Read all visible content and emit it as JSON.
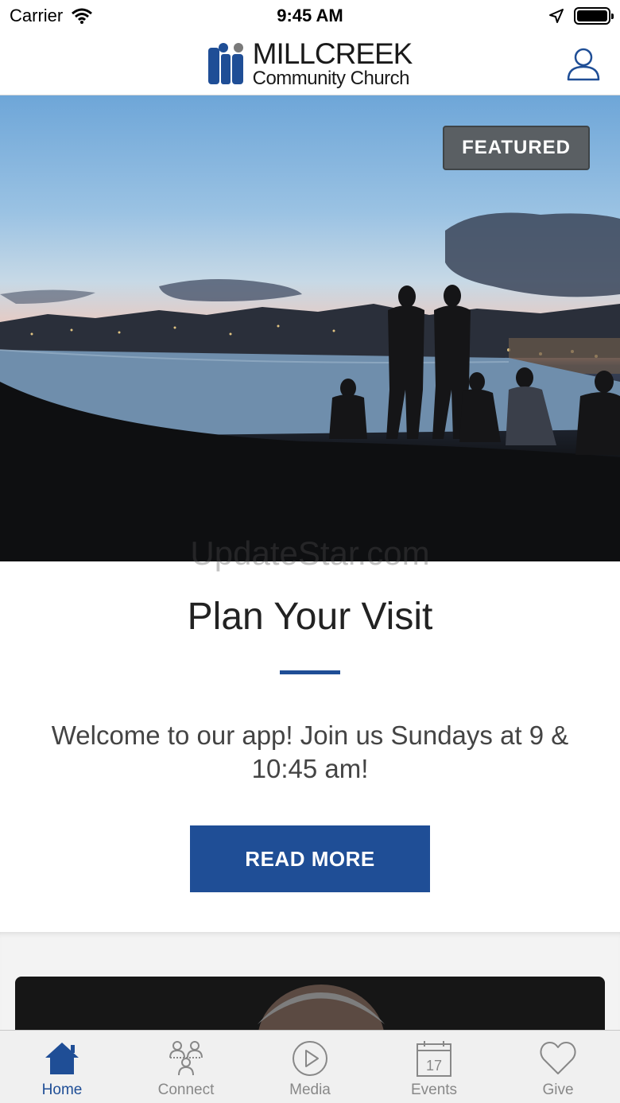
{
  "status_bar": {
    "carrier": "Carrier",
    "time": "9:45 AM"
  },
  "header": {
    "logo_line1": "MILLCREEK",
    "logo_line2": "Community Church"
  },
  "hero": {
    "badge": "FEATURED",
    "watermark": "UpdateStar.com"
  },
  "card": {
    "title": "Plan Your Visit",
    "body": "Welcome to our app! Join us Sundays at 9 & 10:45 am!",
    "button": "READ MORE"
  },
  "tabs": [
    {
      "label": "Home",
      "icon": "home-icon",
      "active": true
    },
    {
      "label": "Connect",
      "icon": "people-icon",
      "active": false
    },
    {
      "label": "Media",
      "icon": "play-icon",
      "active": false
    },
    {
      "label": "Events",
      "icon": "calendar-icon",
      "active": false
    },
    {
      "label": "Give",
      "icon": "heart-icon",
      "active": false
    }
  ],
  "colors": {
    "accent": "#1f4e96",
    "badge": "#5a5f63",
    "tab_inactive": "#888888"
  }
}
